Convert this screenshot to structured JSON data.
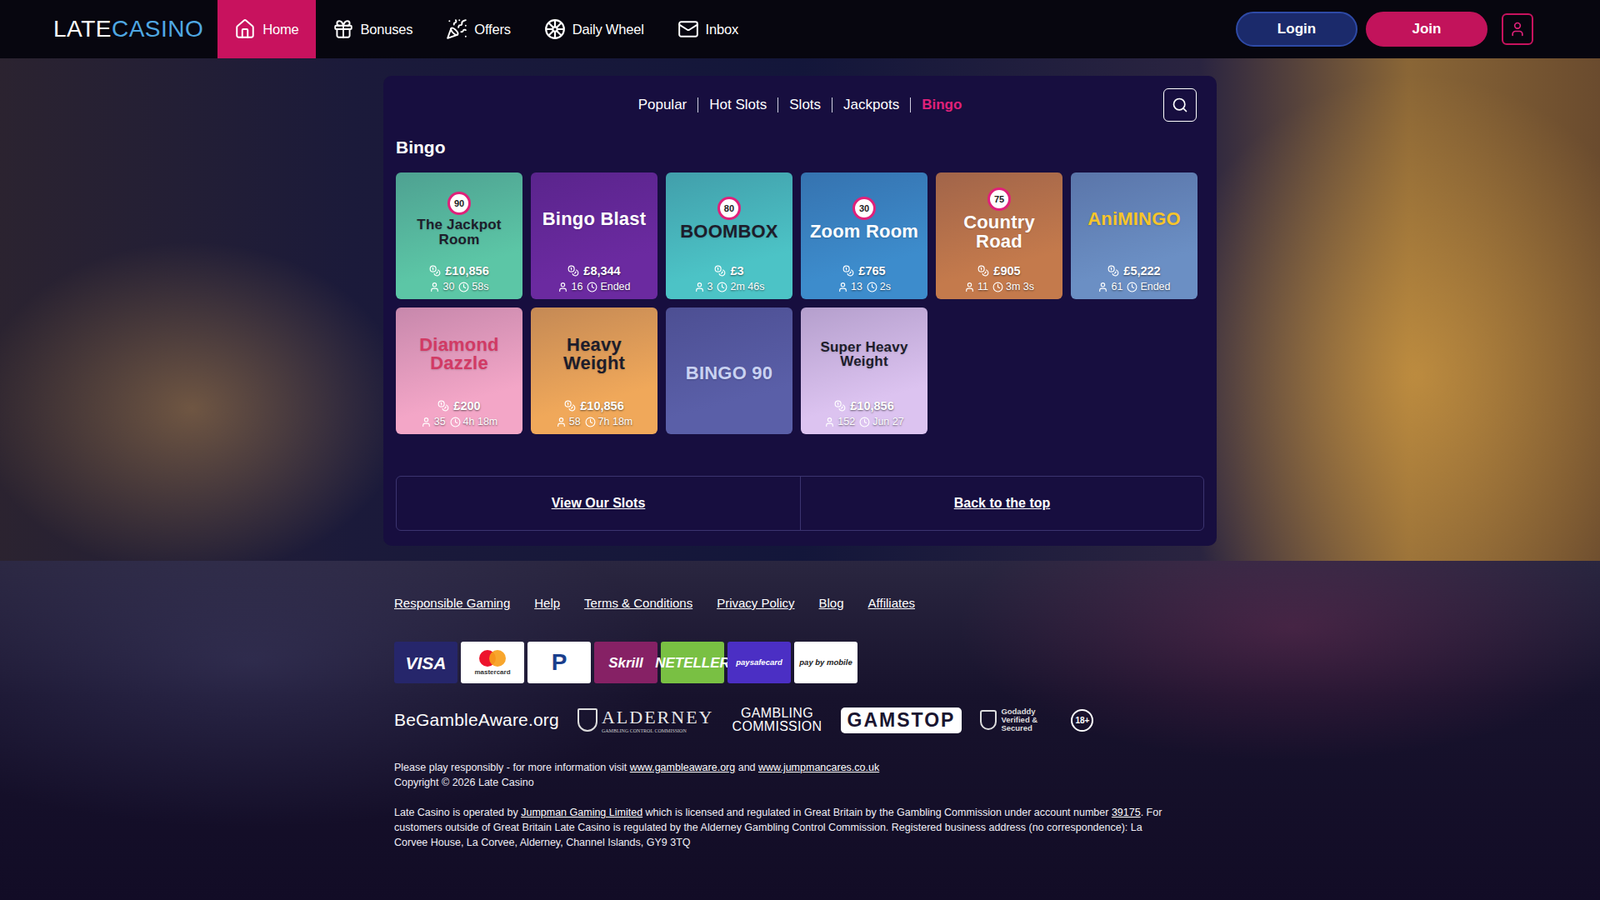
{
  "nav": {
    "logo": [
      "LATE",
      "CASINO"
    ],
    "items": [
      {
        "label": "Home",
        "selected": true
      },
      {
        "label": "Bonuses",
        "selected": false
      },
      {
        "label": "Offers",
        "selected": false
      },
      {
        "label": "Daily Wheel",
        "selected": false
      },
      {
        "label": "Inbox",
        "selected": false
      }
    ],
    "buttons": {
      "login": "Login",
      "join": "Join"
    }
  },
  "tabs": [
    {
      "label": "Popular",
      "selected": false
    },
    {
      "label": "Hot Slots",
      "selected": false
    },
    {
      "label": "Slots",
      "selected": false
    },
    {
      "label": "Jackpots",
      "selected": false
    },
    {
      "label": "Bingo",
      "selected": true
    }
  ],
  "section": {
    "heading": "Bingo"
  },
  "games": [
    {
      "title": "The Jackpot Room",
      "ball": "90",
      "color": "#5cc6a6",
      "ink": "#1d1d2b",
      "jackpot": "£10,856",
      "players": "30",
      "time": "58s"
    },
    {
      "title": "Bingo Blast",
      "ball": "",
      "color": "#6b2aa0",
      "ink": "#ffffff",
      "jackpot": "£8,344",
      "players": "16",
      "time": "Ended"
    },
    {
      "title": "BOOMBOX",
      "ball": "80",
      "color": "#4cc3c6",
      "ink": "#1d1d2b",
      "jackpot": "£3",
      "players": "3",
      "time": "2m 46s"
    },
    {
      "title": "Zoom Room",
      "ball": "30",
      "color": "#3d8ccc",
      "ink": "#ffffff",
      "jackpot": "£765",
      "players": "13",
      "time": "2s"
    },
    {
      "title": "Country Road",
      "ball": "75",
      "color": "#c47a4c",
      "ink": "#ffffff",
      "jackpot": "£905",
      "players": "11",
      "time": "3m 3s"
    },
    {
      "title": "AniMINGO",
      "ball": "",
      "color": "#6b8fc4",
      "ink": "#f7c52a",
      "jackpot": "£5,222",
      "players": "61",
      "time": "Ended"
    },
    {
      "title": "Diamond Dazzle",
      "ball": "",
      "color": "#f3a6c7",
      "ink": "#d23a64",
      "jackpot": "£200",
      "players": "35",
      "time": "4h 18m"
    },
    {
      "title": "Heavy Weight",
      "ball": "",
      "color": "#f0a85a",
      "ink": "#1d1d2b",
      "jackpot": "£10,856",
      "players": "58",
      "time": "7h 18m"
    },
    {
      "title": "BINGO 90",
      "ball": "",
      "color": "#5a5fa8",
      "ink": "#c9d2f2"
    },
    {
      "title": "Super Heavy Weight",
      "ball": "",
      "color": "#dcc3f0",
      "ink": "#1d1d2b",
      "jackpot": "£10,856",
      "players": "152",
      "time": "Jun 27"
    }
  ],
  "actions": [
    "View Our Slots",
    "Back to the top"
  ],
  "footer": {
    "links": [
      "Responsible Gaming",
      "Help",
      "Terms & Conditions",
      "Privacy Policy",
      "Blog",
      "Affiliates"
    ],
    "payments": [
      {
        "label": "VISA",
        "color": "#26266b",
        "ink": "#ffffff"
      },
      {
        "label": "mastercard",
        "color": "#ffffff",
        "ink": "#333333"
      },
      {
        "label": "P",
        "color": "#ffffff",
        "ink": "#1a3e8c"
      },
      {
        "label": "Skrill",
        "color": "#862165",
        "ink": "#ffffff"
      },
      {
        "label": "NETELLER",
        "color": "#79c043",
        "ink": "#ffffff"
      },
      {
        "label": "paysafecard",
        "color": "#4b2fc4",
        "ink": "#ffffff"
      },
      {
        "label": "pay by mobile",
        "color": "#ffffff",
        "ink": "#222222"
      }
    ],
    "regulators": [
      {
        "kind": "bga",
        "text": "BeGambleAware.org",
        "sub": ""
      },
      {
        "kind": "alderney",
        "text": "ALDERNEY",
        "sub": "GAMBLING CONTROL COMMISSION"
      },
      {
        "kind": "gc",
        "text": "GAMBLING COMMISSION",
        "sub": ""
      },
      {
        "kind": "gamstop",
        "text": "GAMSTOP",
        "sub": ""
      },
      {
        "kind": "godaddy",
        "text": "Godaddy Verified & Secured",
        "sub": ""
      },
      {
        "kind": "age",
        "text": "18+",
        "sub": ""
      }
    ],
    "legal": [
      [
        {
          "text": "Please play responsibly - for more information visit ",
          "link": false
        },
        {
          "text": "www.gambleaware.org",
          "link": true
        },
        {
          "text": " and ",
          "link": false
        },
        {
          "text": "www.jumpmancares.co.uk",
          "link": true
        }
      ],
      [
        {
          "text": "Copyright © 2026 Late Casino",
          "link": false
        }
      ],
      [
        {
          "text": "Late Casino is operated by ",
          "link": false
        },
        {
          "text": "Jumpman Gaming Limited",
          "link": true
        },
        {
          "text": " which is licensed and regulated in Great Britain by the Gambling Commission under account number ",
          "link": false
        },
        {
          "text": "39175",
          "link": true
        },
        {
          "text": ". For customers outside of Great Britain Late Casino is regulated by the Alderney Gambling Control Commission. Registered business address (no correspondence): La Corvee House, La Corvee, Alderney, Channel Islands, GY9 3TQ",
          "link": false
        }
      ]
    ]
  }
}
